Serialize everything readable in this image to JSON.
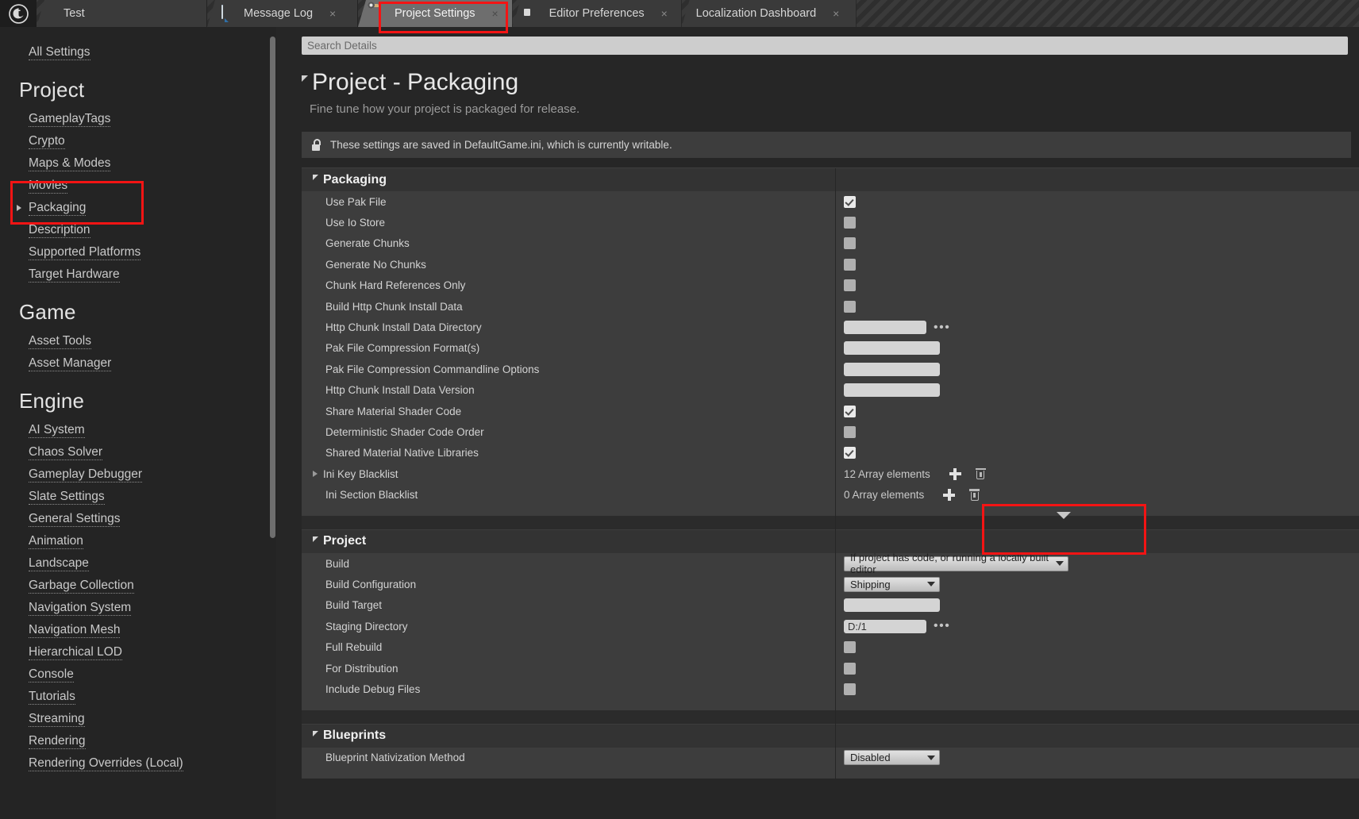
{
  "window": {
    "logo_icon": "unreal-engine-logo"
  },
  "tabs": [
    {
      "label": "Test",
      "icon": "",
      "active": false,
      "closable": false
    },
    {
      "label": "Message Log",
      "icon": "message-log-icon",
      "active": false,
      "closable": true
    },
    {
      "label": "Project Settings",
      "icon": "project-settings-icon",
      "active": true,
      "closable": true
    },
    {
      "label": "Editor Preferences",
      "icon": "editor-preferences-icon",
      "active": false,
      "closable": true
    },
    {
      "label": "Localization Dashboard",
      "icon": "",
      "active": false,
      "closable": true
    }
  ],
  "sidebar": {
    "all_settings": "All Settings",
    "groups": [
      {
        "heading": "Project",
        "items": [
          {
            "label": "GameplayTags",
            "expandable": false
          },
          {
            "label": "Crypto",
            "expandable": false
          },
          {
            "label": "Maps & Modes",
            "expandable": false
          },
          {
            "label": "Movies",
            "expandable": false
          },
          {
            "label": "Packaging",
            "expandable": true
          },
          {
            "label": "Description",
            "expandable": false
          },
          {
            "label": "Supported Platforms",
            "expandable": false
          },
          {
            "label": "Target Hardware",
            "expandable": false
          }
        ]
      },
      {
        "heading": "Game",
        "items": [
          {
            "label": "Asset Tools",
            "expandable": false
          },
          {
            "label": "Asset Manager",
            "expandable": false
          }
        ]
      },
      {
        "heading": "Engine",
        "items": [
          {
            "label": "AI System",
            "expandable": false
          },
          {
            "label": "Chaos Solver",
            "expandable": false
          },
          {
            "label": "Gameplay Debugger",
            "expandable": false
          },
          {
            "label": "Slate Settings",
            "expandable": false
          },
          {
            "label": "General Settings",
            "expandable": false
          },
          {
            "label": "Animation",
            "expandable": false
          },
          {
            "label": "Landscape",
            "expandable": false
          },
          {
            "label": "Garbage Collection",
            "expandable": false
          },
          {
            "label": "Navigation System",
            "expandable": false
          },
          {
            "label": "Navigation Mesh",
            "expandable": false
          },
          {
            "label": "Hierarchical LOD",
            "expandable": false
          },
          {
            "label": "Console",
            "expandable": false
          },
          {
            "label": "Tutorials",
            "expandable": false
          },
          {
            "label": "Streaming",
            "expandable": false
          },
          {
            "label": "Rendering",
            "expandable": false
          },
          {
            "label": "Rendering Overrides (Local)",
            "expandable": false
          }
        ]
      }
    ]
  },
  "main": {
    "search": {
      "placeholder": "Search Details",
      "value": ""
    },
    "title": "Project - Packaging",
    "subtitle": "Fine tune how your project is packaged for release.",
    "notice": "These settings are saved in DefaultGame.ini, which is currently writable.",
    "notice_icon": "unlocked-padlock-icon",
    "sections": [
      {
        "title": "Packaging",
        "rows": [
          {
            "label": "Use Pak File",
            "type": "checkbox",
            "checked": true
          },
          {
            "label": "Use Io Store",
            "type": "checkbox",
            "checked": false
          },
          {
            "label": "Generate Chunks",
            "type": "checkbox",
            "checked": false
          },
          {
            "label": "Generate No Chunks",
            "type": "checkbox",
            "checked": false
          },
          {
            "label": "Chunk Hard References Only",
            "type": "checkbox",
            "checked": false
          },
          {
            "label": "Build Http Chunk Install Data",
            "type": "checkbox",
            "checked": false
          },
          {
            "label": "Http Chunk Install Data Directory",
            "type": "text-browse",
            "value": ""
          },
          {
            "label": "Pak File Compression Format(s)",
            "type": "text",
            "value": ""
          },
          {
            "label": "Pak File Compression Commandline Options",
            "type": "text",
            "value": ""
          },
          {
            "label": "Http Chunk Install Data Version",
            "type": "text",
            "value": ""
          },
          {
            "label": "Share Material Shader Code",
            "type": "checkbox",
            "checked": true
          },
          {
            "label": "Deterministic Shader Code Order",
            "type": "checkbox",
            "checked": false
          },
          {
            "label": "Shared Material Native Libraries",
            "type": "checkbox",
            "checked": true
          },
          {
            "label": "Ini Key Blacklist",
            "type": "array",
            "value": "12 Array elements",
            "expandable": true
          },
          {
            "label": "Ini Section Blacklist",
            "type": "array",
            "value": "0 Array elements",
            "expandable": false
          }
        ]
      },
      {
        "title": "Project",
        "rows": [
          {
            "label": "Build",
            "type": "combo",
            "value": "If project has code, or running a locally built editor"
          },
          {
            "label": "Build Configuration",
            "type": "combo",
            "value": "Shipping"
          },
          {
            "label": "Build Target",
            "type": "text",
            "value": ""
          },
          {
            "label": "Staging Directory",
            "type": "text-browse",
            "value": "D:/1"
          },
          {
            "label": "Full Rebuild",
            "type": "checkbox",
            "checked": false
          },
          {
            "label": "For Distribution",
            "type": "checkbox",
            "checked": false
          },
          {
            "label": "Include Debug Files",
            "type": "checkbox",
            "checked": false
          }
        ]
      },
      {
        "title": "Blueprints",
        "rows": [
          {
            "label": "Blueprint Nativization Method",
            "type": "combo",
            "value": "Disabled"
          }
        ]
      }
    ]
  },
  "annotations": {
    "accent_color": "#f31414",
    "boxes": [
      {
        "target": "tab-project-settings"
      },
      {
        "target": "sidebar-item-packaging"
      },
      {
        "target": "build-dropdown-area"
      }
    ]
  }
}
